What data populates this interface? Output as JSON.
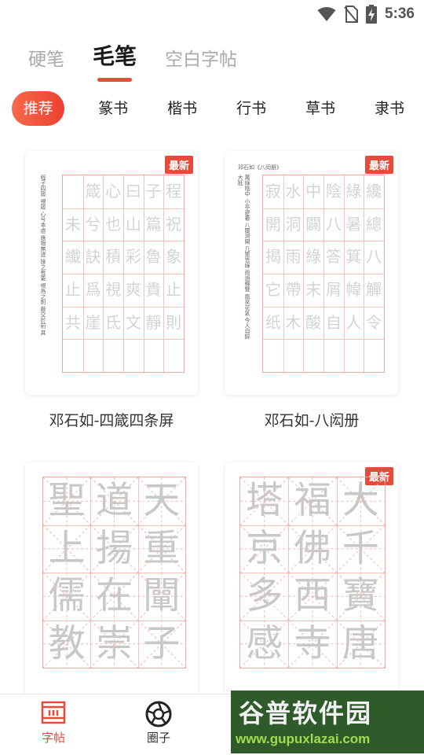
{
  "status_bar": {
    "time": "5:36"
  },
  "top_tabs": [
    {
      "label": "硬笔",
      "active": false
    },
    {
      "label": "毛笔",
      "active": true
    },
    {
      "label": "空白字帖",
      "active": false
    }
  ],
  "chips": [
    {
      "label": "推荐",
      "active": true
    },
    {
      "label": "篆书"
    },
    {
      "label": "楷书"
    },
    {
      "label": "行书"
    },
    {
      "label": "草书"
    },
    {
      "label": "隶书"
    }
  ],
  "cards": [
    {
      "title": "邓石如-四箴四条屏",
      "badge": "最新",
      "grid_cols": 6,
      "grid_rows": 6,
      "glyphs": [
        "程",
        "祝",
        "象",
        "止",
        "則",
        "",
        "子",
        "篇",
        "魯",
        "貴",
        "靜",
        "",
        "曰",
        "山",
        "彩",
        "爽",
        "文",
        "",
        "心",
        "也",
        "積",
        "視",
        "氐",
        "",
        "箴",
        "兮",
        "訣",
        "爲",
        "崖",
        "",
        "",
        "未",
        "纎",
        "止",
        "共",
        ""
      ],
      "side_text": "程子四箴 視箴 心兮本虛 應物無迹 操之有要 視為之則 蔽交於前 其"
    },
    {
      "title": "邓石如-八闳册",
      "badge": "最新",
      "caption": "邓石如《八闳册》",
      "grid_cols": 6,
      "grid_rows": 6,
      "glyphs": [
        "纔",
        "總",
        "八",
        "觶",
        "令",
        "",
        "綠",
        "暑",
        "箕",
        "幃",
        "人",
        "",
        "陰",
        "八",
        "答",
        "屑",
        "自",
        "",
        "中",
        "闢",
        "綠",
        "末",
        "酸",
        "",
        "水",
        "洞",
        "雨",
        "帶",
        "木",
        "",
        "寂",
        "開",
        "揭",
        "它",
        "纸",
        ""
      ],
      "side_text": "萬綠陰中 小亭避暑 八闥洞開 几簟皆綠 雨過蟬聲 風來花氣 今人自醉 大抵"
    },
    {
      "title": "",
      "badge": "",
      "grid_cols": 3,
      "grid_rows": 4,
      "glyphs": [
        "天",
        "重",
        "闡",
        "子",
        "道",
        "揚",
        "在",
        "崇",
        "聖",
        "上",
        "儒",
        "教"
      ]
    },
    {
      "title": "",
      "badge": "最新",
      "grid_cols": 3,
      "grid_rows": 4,
      "glyphs": [
        "大",
        "千",
        "寶",
        "唐",
        "福",
        "佛",
        "西",
        "寺",
        "塔",
        "京",
        "多",
        "感"
      ]
    }
  ],
  "bottom_nav": [
    {
      "label": "字帖",
      "icon": "copybook-icon",
      "active": true
    },
    {
      "label": "圈子",
      "icon": "aperture-icon",
      "active": false
    }
  ],
  "watermark": {
    "title": "谷普软件园",
    "url": "www.gupuxlazai.com"
  },
  "colors": {
    "accent": "#ee4a3a",
    "grid": "#f1a8a0",
    "watermark_bg": "#2f5a2a"
  }
}
